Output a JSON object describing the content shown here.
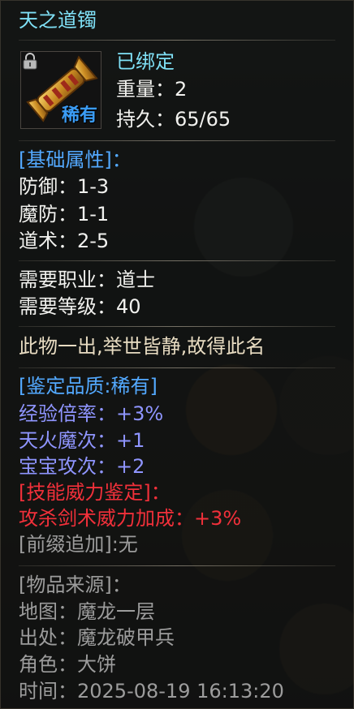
{
  "item": {
    "name": "天之道镯",
    "rarity_badge": "稀有",
    "bind_status": "已绑定",
    "weight_label": "重量：",
    "weight_value": "2",
    "durability_label": "持久：",
    "durability_value": "65/65"
  },
  "base_attributes": {
    "header": "[基础属性]：",
    "rows": [
      {
        "label": "防御：",
        "value": "1-3"
      },
      {
        "label": "魔防：",
        "value": "1-1"
      },
      {
        "label": "道术：",
        "value": "2-5"
      }
    ]
  },
  "requirements": {
    "rows": [
      {
        "label": "需要职业：",
        "value": "道士"
      },
      {
        "label": "需要等级：",
        "value": "40"
      }
    ]
  },
  "description": "此物一出,举世皆静,故得此名",
  "appraisal": {
    "header": "[鉴定品质:稀有]",
    "rows": [
      {
        "label": "经验倍率：",
        "value": "+3%"
      },
      {
        "label": "天火魔次：",
        "value": "+1"
      },
      {
        "label": "宝宝攻次：",
        "value": "+2"
      }
    ]
  },
  "skill_appraisal": {
    "header": "[技能威力鉴定]：",
    "row_label": "攻杀剑术威力加成：",
    "row_value": "+3%"
  },
  "prefix": "[前缀追加]:无",
  "source": {
    "header": "[物品来源]：",
    "rows": [
      {
        "label": "地图：",
        "value": "魔龙一层"
      },
      {
        "label": "出处：",
        "value": "魔龙破甲兵"
      },
      {
        "label": "角色：",
        "value": "大饼"
      },
      {
        "label": "时间：",
        "value": "2025-08-19 16:13:20"
      }
    ]
  },
  "colors": {
    "title": "#7fe0f6",
    "rarity": "#3b9cf5",
    "appraisal": "#8f95ff",
    "skill": "#f1303a",
    "prefix": "#9c9c9c"
  },
  "icons": {
    "item": "bracelet-icon",
    "lock": "lock-icon"
  }
}
